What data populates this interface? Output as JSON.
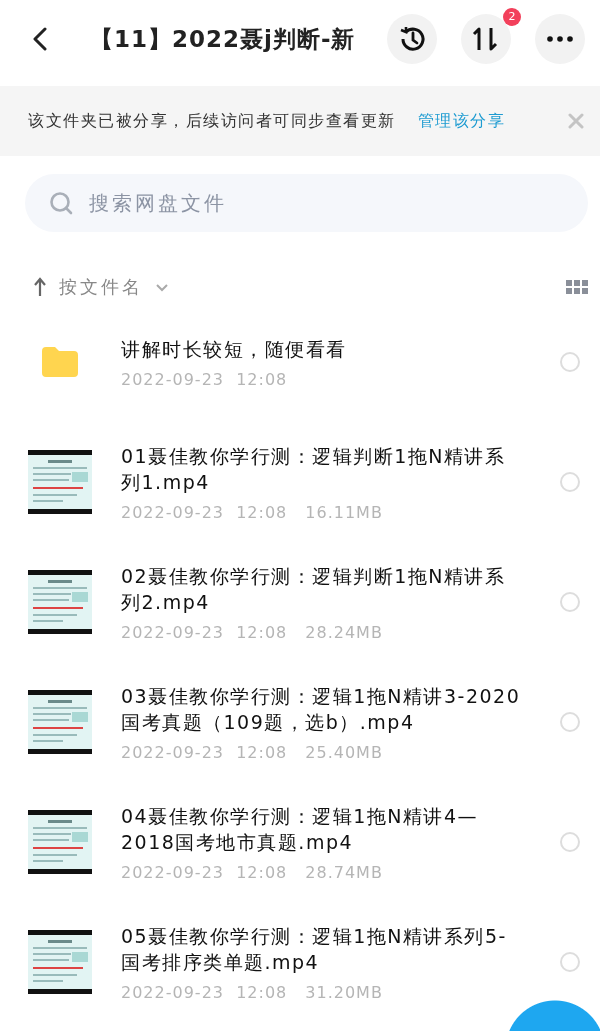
{
  "header": {
    "title": "【11】2022聂j判断-新",
    "transfer_badge": "2"
  },
  "share_banner": {
    "message": "该文件夹已被分享，后续访问者可同步查看更新",
    "link": "管理该分享"
  },
  "search": {
    "placeholder": "搜索网盘文件"
  },
  "sort": {
    "label": "按文件名"
  },
  "files": [
    {
      "kind": "folder",
      "name": "讲解时长较短，随便看看",
      "date": "2022-09-23  12:08",
      "selected": false
    },
    {
      "kind": "video",
      "name": "01聂佳教你学行测：逻辑判断1拖N精讲系列1.mp4",
      "date": "2022-09-23  12:08",
      "size": "16.11MB",
      "selected": false
    },
    {
      "kind": "video",
      "name": "02聂佳教你学行测：逻辑判断1拖N精讲系列2.mp4",
      "date": "2022-09-23  12:08",
      "size": "28.24MB",
      "selected": false
    },
    {
      "kind": "video",
      "name": "03聂佳教你学行测：逻辑1拖N精讲3-2020国考真题（109题，选b）.mp4",
      "date": "2022-09-23  12:08",
      "size": "25.40MB",
      "selected": false
    },
    {
      "kind": "video",
      "name": "04聂佳教你学行测：逻辑1拖N精讲4—2018国考地市真题.mp4",
      "date": "2022-09-23  12:08",
      "size": "28.74MB",
      "selected": false
    },
    {
      "kind": "video",
      "name": "05聂佳教你学行测：逻辑1拖N精讲系列5-国考排序类单题.mp4",
      "date": "2022-09-23  12:08",
      "size": "31.20MB",
      "selected": false
    }
  ]
}
